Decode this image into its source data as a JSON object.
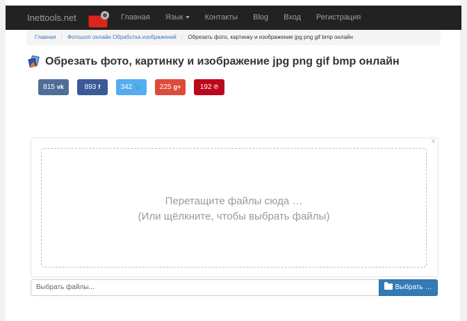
{
  "navbar": {
    "brand": "Inettools.net",
    "items": [
      {
        "label": "Главная"
      },
      {
        "label": "Язык"
      },
      {
        "label": "Контакты"
      },
      {
        "label": "Blog"
      },
      {
        "label": "Вход"
      },
      {
        "label": "Регистрация"
      }
    ]
  },
  "breadcrumb": {
    "home": "Главная",
    "section": "Фотошоп онлайн Обработка изображений",
    "current": "Обрезать фото, картинку и изображение jpg png gif bmp онлайн"
  },
  "page": {
    "title": "Обрезать фото, картинку и изображение jpg png gif bmp онлайн"
  },
  "share": [
    {
      "count": "815",
      "glyph": "vk",
      "icon": "vk-icon",
      "color": "#4e6e97"
    },
    {
      "count": "893",
      "glyph": "f",
      "icon": "facebook-icon",
      "color": "#3b5998"
    },
    {
      "count": "342",
      "glyph": "🐦",
      "icon": "twitter-icon",
      "color": "#55acee"
    },
    {
      "count": "225",
      "glyph": "g+",
      "icon": "google-plus-icon",
      "color": "#dd4b39"
    },
    {
      "count": "192",
      "glyph": "℗",
      "icon": "pinterest-icon",
      "color": "#bd081c"
    }
  ],
  "dropzone": {
    "close": "×",
    "line1": "Перетащите файлы сюда …",
    "line2": "(Или щёлкните, чтобы выбрать файлы)"
  },
  "file_input": {
    "placeholder": "Выбрать файлы...",
    "button_label": "Выбрать …"
  },
  "colors": {
    "navbar_bg": "#222222",
    "primary_button": "#337ab7",
    "link": "#3f78b8"
  }
}
